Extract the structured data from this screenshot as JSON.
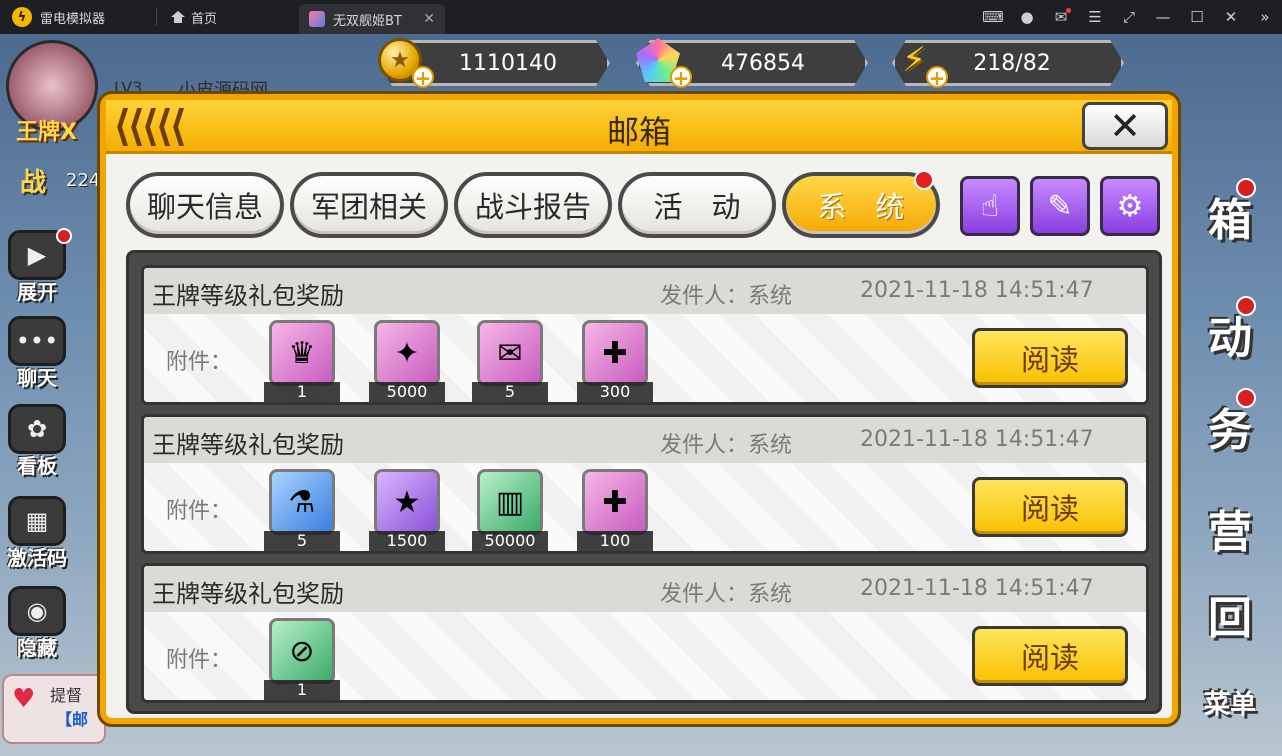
{
  "titlebar": {
    "app_name": "雷电模拟器",
    "home_tab": "首页",
    "game_tab": "无双舰姬BT",
    "close_tab_glyph": "✕",
    "buttons": [
      "gamepad-icon",
      "account-icon",
      "mail-icon",
      "menu-icon",
      "restore-icon",
      "minimize-icon",
      "maximize-icon",
      "close-icon",
      "collapse-icon"
    ]
  },
  "player": {
    "level": "LV3",
    "name": "小皮源码网",
    "rank_title": "王牌X",
    "power_label": "战",
    "power_value": "224"
  },
  "resources": [
    {
      "name": "gold",
      "value": "1110140"
    },
    {
      "name": "gem",
      "value": "476854"
    },
    {
      "name": "energy",
      "value": "218/82"
    }
  ],
  "left_menu": [
    {
      "label": "展开",
      "glyph": "▶",
      "dot": true
    },
    {
      "label": "聊天",
      "glyph": "•••",
      "dot": false
    },
    {
      "label": "看板",
      "glyph": "✿",
      "dot": false
    },
    {
      "label": "激活码",
      "glyph": "▦",
      "dot": false
    },
    {
      "label": "隐藏",
      "glyph": "◉",
      "dot": false
    }
  ],
  "notice": {
    "line1": "提督",
    "line2": "【邮"
  },
  "right_menu": [
    "箱",
    "动",
    "务",
    "营",
    "回",
    "菜单"
  ],
  "dialog": {
    "title": "邮箱",
    "close_glyph": "✕",
    "tabs": [
      "聊天信息",
      "军团相关",
      "战斗报告",
      "活　动",
      "系　统"
    ],
    "active_tab": 4,
    "tools": [
      "☝",
      "✎",
      "⚙"
    ]
  },
  "mails": [
    {
      "subject": "王牌等级礼包奖励",
      "sender": "发件人：系统",
      "time": "2021-11-18 14:51:47",
      "attach_label": "附件：",
      "read_label": "阅读",
      "items": [
        {
          "icon": "character-card-icon",
          "glyph": "♛",
          "qty": "1",
          "frame": "pink"
        },
        {
          "icon": "blue-medal-icon",
          "glyph": "✦",
          "qty": "5000",
          "frame": "pink"
        },
        {
          "icon": "supply-bag-icon",
          "glyph": "✉",
          "qty": "5",
          "frame": "pink"
        },
        {
          "icon": "gold-puzzle-icon",
          "glyph": "✚",
          "qty": "300",
          "frame": "pink"
        }
      ]
    },
    {
      "subject": "王牌等级礼包奖励",
      "sender": "发件人：系统",
      "time": "2021-11-18 14:51:47",
      "attach_label": "附件：",
      "read_label": "阅读",
      "items": [
        {
          "icon": "potion-flask-icon",
          "glyph": "⚗",
          "qty": "5",
          "frame": "blue"
        },
        {
          "icon": "purple-star-coin-icon",
          "glyph": "★",
          "qty": "1500",
          "frame": "purple"
        },
        {
          "icon": "fuel-canisters-icon",
          "glyph": "▥",
          "qty": "50000",
          "frame": "green"
        },
        {
          "icon": "gold-puzzle-icon",
          "glyph": "✚",
          "qty": "100",
          "frame": "pink"
        }
      ]
    },
    {
      "subject": "王牌等级礼包奖励",
      "sender": "发件人：系统",
      "time": "2021-11-18 14:51:47",
      "attach_label": "附件：",
      "read_label": "阅读",
      "items": [
        {
          "icon": "test-tube-icon",
          "glyph": "⊘",
          "qty": "1",
          "frame": "green"
        }
      ]
    }
  ]
}
